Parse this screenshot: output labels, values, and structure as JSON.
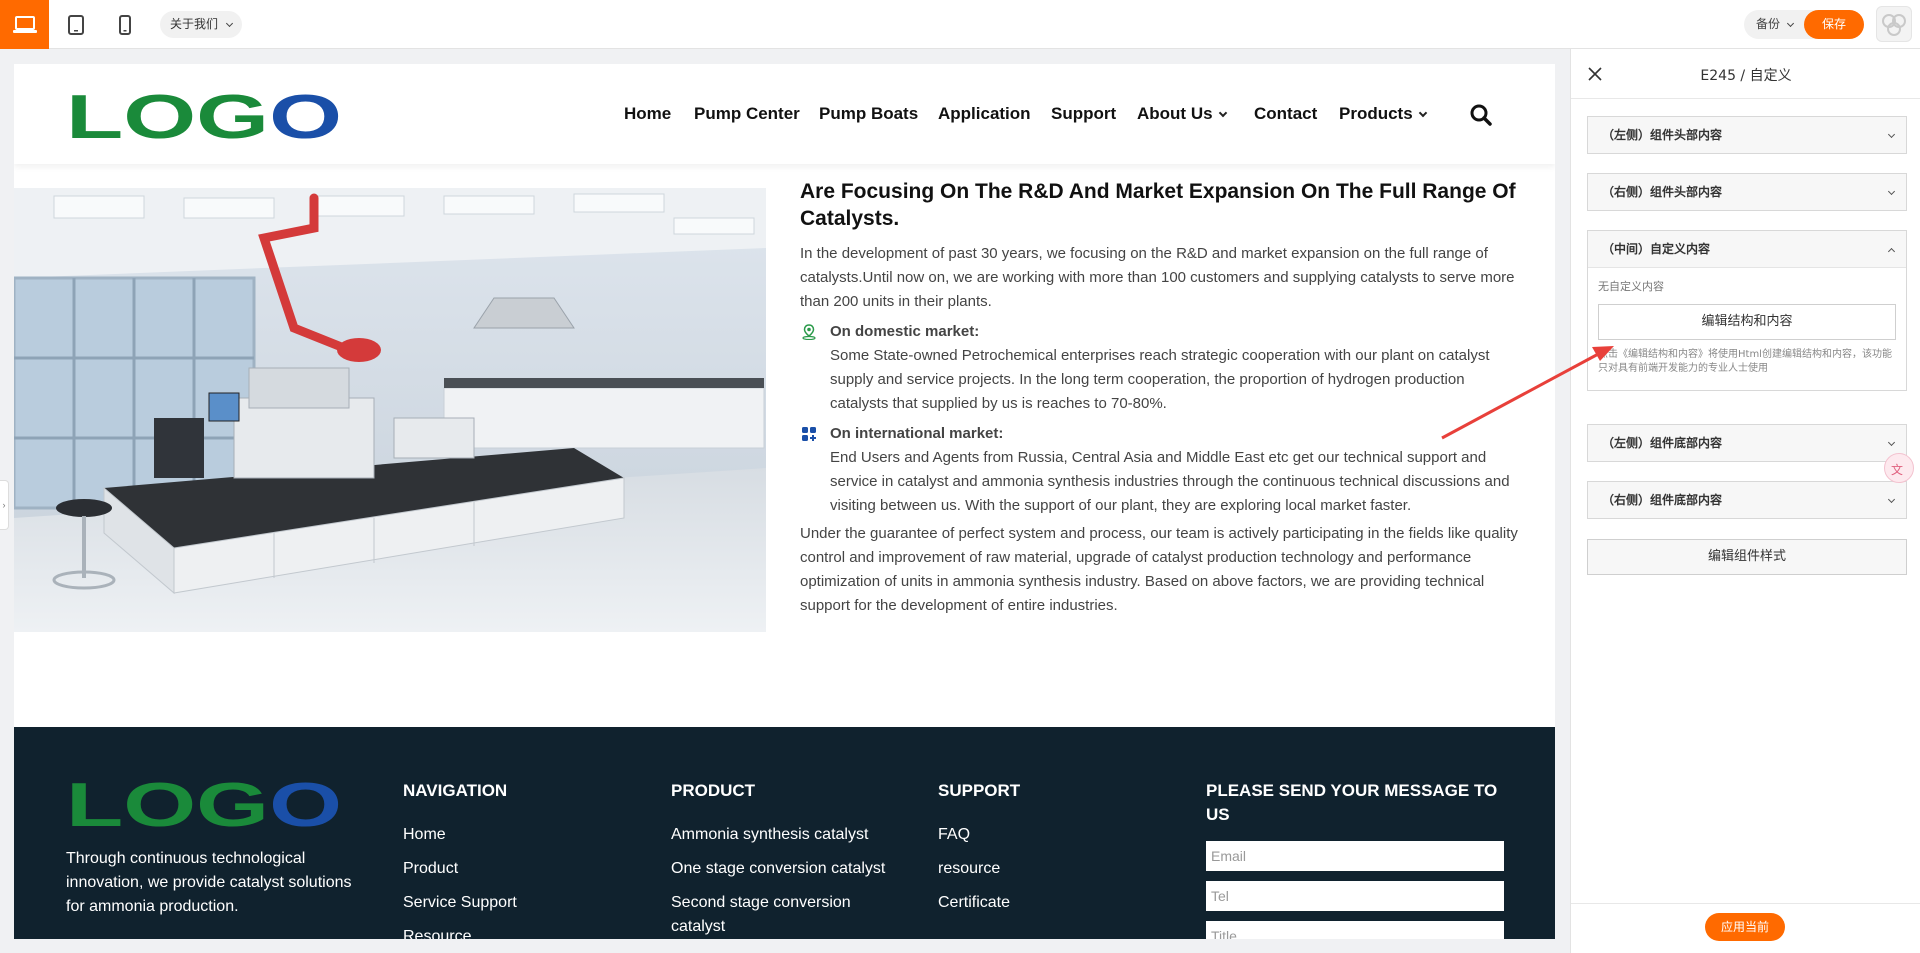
{
  "toolbar": {
    "devices": [
      {
        "icon": "laptop-icon",
        "active": true
      },
      {
        "icon": "tablet-icon",
        "active": false
      },
      {
        "icon": "phone-icon",
        "active": false
      }
    ],
    "page_select": "关于我们",
    "backup_label": "备份",
    "save_label": "保存",
    "accent": "#ff6a00"
  },
  "site": {
    "logo_text": "LOGO",
    "logo_colors": [
      "#1a8a3a",
      "#1a4fa8"
    ],
    "nav": [
      "Home",
      "Pump Center",
      "Pump Boats",
      "Application",
      "Support",
      "About Us",
      "Contact",
      "Products"
    ],
    "nav_dropdown": [
      "About Us",
      "Products"
    ]
  },
  "main": {
    "headline": "Are Focusing On The R&D And Market Expansion On The Full Range Of Catalysts.",
    "intro": "In the development of past 30 years, we focusing on the R&D and market expansion on the full range of catalysts.Until now on, we are working with more than 100 customers and supplying catalysts to serve more than 200 units in their plants.",
    "bullets": [
      {
        "icon": "location-icon",
        "title": "On domestic market:",
        "text": "Some State-owned Petrochemical enterprises reach strategic cooperation with our plant on catalyst supply and service projects. In the long term cooperation, the proportion of hydrogen production catalysts that supplied by us is reaches to 70-80%."
      },
      {
        "icon": "grid-icon",
        "title": "On international market:",
        "text": "End Users and Agents from Russia, Central Asia and Middle East etc get our technical support and service in catalyst and ammonia synthesis industries through the continuous technical discussions and visiting between us. With the support of our plant, they are exploring local market faster."
      }
    ],
    "outro": "Under the guarantee of perfect system and process, our team is actively participating in the fields like quality control and improvement of raw material, upgrade of catalyst production technology and performance optimization of units in ammonia synthesis industry. Based on above factors, we are providing technical support for the development of entire industries."
  },
  "footer": {
    "tagline": "Through continuous technological innovation, we provide catalyst solutions for ammonia production.",
    "navigation": {
      "title": "NAVIGATION",
      "links": [
        "Home",
        "Product",
        "Service Support",
        "Resource"
      ]
    },
    "product": {
      "title": "PRODUCT",
      "links": [
        "Ammonia synthesis catalyst",
        "One stage conversion catalyst",
        "Second stage conversion catalyst"
      ]
    },
    "support": {
      "title": "SUPPORT",
      "links": [
        "FAQ",
        "resource",
        "Certificate"
      ]
    },
    "message": {
      "title": "PLEASE SEND YOUR MESSAGE TO US",
      "email_placeholder": "Email",
      "tel_placeholder": "Tel",
      "title_placeholder": "Title"
    },
    "bg_color": "#10222e"
  },
  "panel": {
    "title": "E245 / 自定义",
    "sections": [
      {
        "label": "（左侧）组件头部内容",
        "expanded": false
      },
      {
        "label": "（右侧）组件头部内容",
        "expanded": false
      },
      {
        "label": "（中间）自定义内容",
        "expanded": true
      },
      {
        "label": "（左侧）组件底部内容",
        "expanded": false
      },
      {
        "label": "（右侧）组件底部内容",
        "expanded": false
      }
    ],
    "custom_note": "无自定义内容",
    "edit_button": "编辑结构和内容",
    "edit_hint": "点击《编辑结构和内容》将使用Html创建编辑结构和内容，该功能只对具有前端开发能力的专业人士使用",
    "style_button": "编辑组件样式",
    "apply_button": "应用当前"
  }
}
